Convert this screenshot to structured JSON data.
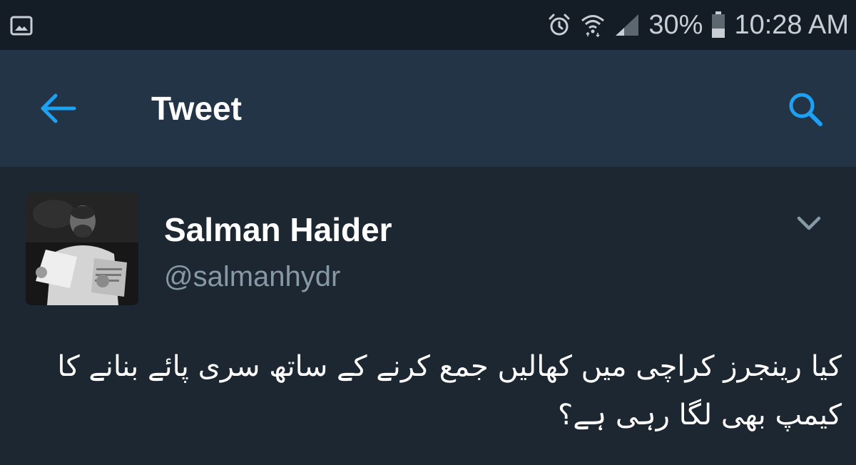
{
  "status_bar": {
    "left_icon": "image-icon",
    "icons": [
      "alarm-icon",
      "wifi-icon",
      "signal-icon"
    ],
    "battery_percent": "30%",
    "battery_icon": "battery-icon",
    "time": "10:28 AM"
  },
  "app_bar": {
    "back_icon": "arrow-left-icon",
    "title": "Tweet",
    "search_icon": "search-icon"
  },
  "tweet": {
    "author": {
      "name": "Salman Haider",
      "handle": "@salmanhydr",
      "avatar_icon": "avatar-photo"
    },
    "menu_icon": "chevron-down-icon",
    "text": "کیا رینجرز کراچی میں کھالیں جمع کرنے کے ساتھ سری پائے بنانے کا کیمپ بھی لگا رہی ہے؟"
  },
  "colors": {
    "status_bar_bg": "#141d26",
    "app_bar_bg": "#243447",
    "content_bg": "#1c2732",
    "accent": "#1da1f2",
    "secondary_text": "#8899a6"
  }
}
